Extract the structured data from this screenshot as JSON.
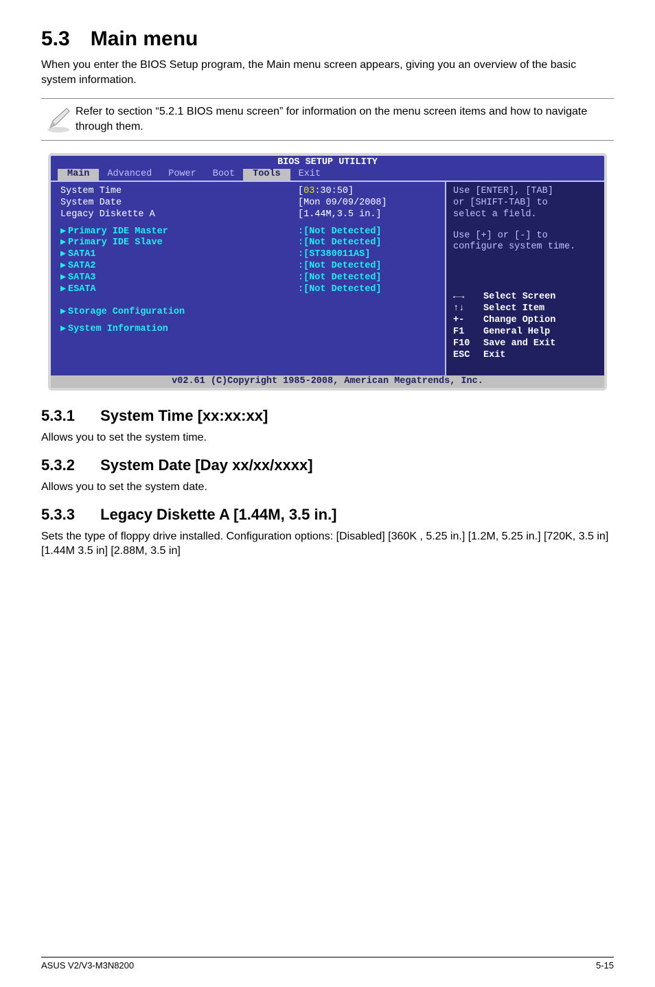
{
  "doc": {
    "heading": "5.3 Main menu",
    "intro": "When you enter the BIOS Setup program, the Main menu screen appears, giving you an overview of the basic system information.",
    "note": "Refer to section “5.2.1 BIOS menu screen” for information on the menu screen items and how to navigate through them.",
    "sections": [
      {
        "num": "5.3.1",
        "title": "System Time [xx:xx:xx]",
        "body": "Allows you to set the system time."
      },
      {
        "num": "5.3.2",
        "title": "System Date [Day xx/xx/xxxx]",
        "body": "Allows you to set the system date."
      },
      {
        "num": "5.3.3",
        "title": "Legacy Diskette A [1.44M, 3.5 in.]",
        "body": "Sets the type of floppy drive installed. Configuration options: [Disabled] [360K , 5.25 in.] [1.2M, 5.25 in.] [720K, 3.5 in] [1.44M 3.5 in] [2.88M, 3.5 in]"
      }
    ],
    "footer_left": "ASUS V2/V3-M3N8200",
    "footer_right": "5-15"
  },
  "bios": {
    "banner": "BIOS SETUP UTILITY",
    "tabs": [
      "Main",
      "Advanced",
      "Power",
      "Boot",
      "Tools",
      "Exit"
    ],
    "selected_tab": "Main",
    "rows_top": [
      {
        "label": "System Time",
        "value_parts": [
          "[",
          "03",
          ":30:50]"
        ],
        "highlight": true
      },
      {
        "label": "System Date",
        "value": "[Mon 09/09/2008]",
        "highlight": true
      },
      {
        "label": "Legacy Diskette A",
        "value": "[1.44M,3.5 in.]",
        "highlight": true
      }
    ],
    "rows_mid": [
      {
        "label": "Primary IDE Master",
        "value": ":[Not Detected]"
      },
      {
        "label": "Primary IDE Slave",
        "value": ":[Not Detected]"
      },
      {
        "label": "SATA1",
        "value": ":[ST380011AS]"
      },
      {
        "label": "SATA2",
        "value": ":[Not Detected]"
      },
      {
        "label": "SATA3",
        "value": ":[Not Detected]"
      },
      {
        "label": "ESATA",
        "value": ":[Not Detected]"
      }
    ],
    "rows_bottom": [
      {
        "label": "Storage Configuration"
      },
      {
        "label": "System Information"
      }
    ],
    "help": {
      "lines": [
        "Use [ENTER], [TAB]",
        "or [SHIFT-TAB] to",
        "select a field.",
        "",
        "Use [+] or [-] to",
        "configure system time."
      ],
      "legend": [
        {
          "sym": "←→",
          "lab": "Select Screen"
        },
        {
          "sym": "↑↓",
          "lab": "Select Item"
        },
        {
          "sym": "+-",
          "lab": "Change Option"
        },
        {
          "sym": "F1",
          "lab": "General Help"
        },
        {
          "sym": "F10",
          "lab": "Save and Exit"
        },
        {
          "sym": "ESC",
          "lab": "Exit"
        }
      ]
    },
    "footer": "v02.61 (C)Copyright 1985-2008, American Megatrends, Inc."
  }
}
